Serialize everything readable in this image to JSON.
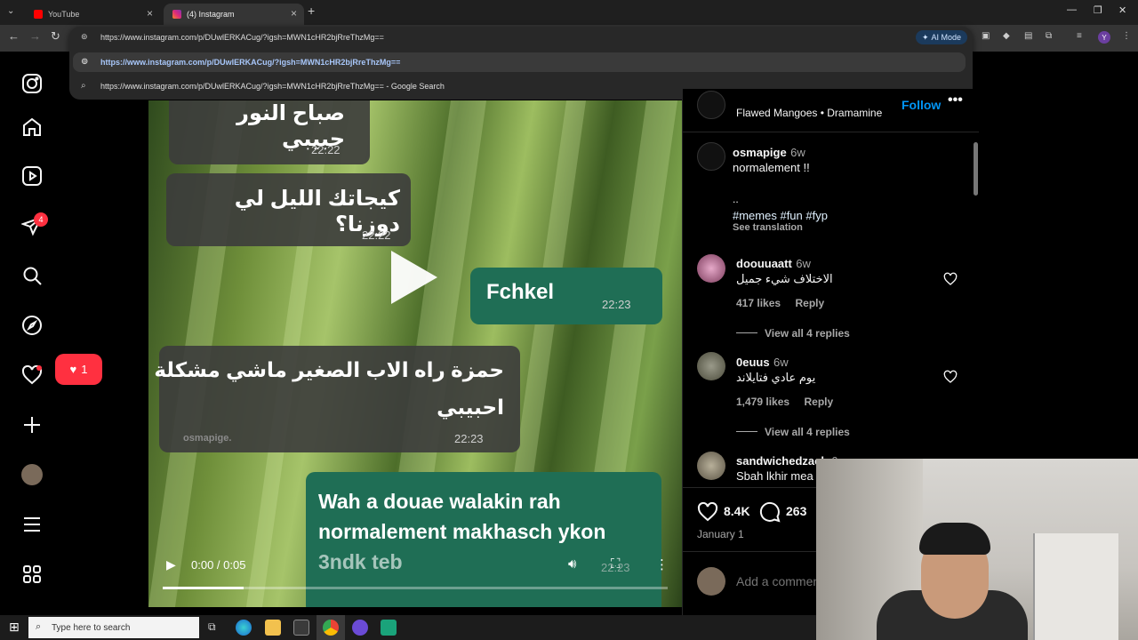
{
  "browser": {
    "tabs": [
      {
        "title": "YouTube"
      },
      {
        "title": "(4) Instagram"
      }
    ],
    "url": "https://www.instagram.com/p/DUwlERKACug/?igsh=MWN1cHR2bjRreThzMg==",
    "suggestions": [
      {
        "text": "https://www.instagram.com/p/DUwlERKACug/?igsh=MWN1cHR2bjRreThzMg=="
      },
      {
        "text": "https://www.instagram.com/p/DUwlERKACug/?igsh=MWN1cHR2bjRreThzMg== - Google Search"
      }
    ],
    "ai_mode_label": "AI Mode",
    "profile_initial": "Y"
  },
  "instagram": {
    "notifications_count": "4",
    "likes_bubble_count": "1",
    "post_header": {
      "audio": "Flawed Mangoes • Dramamine",
      "follow_label": "Follow"
    },
    "caption": {
      "username": "osmapige",
      "time": "6w",
      "text": "normalement !!",
      "dots": "..",
      "hashtags": "#memes #fun #fyp",
      "see_translation": "See translation"
    },
    "comments": [
      {
        "username": "doouuaatt",
        "time": "6w",
        "text": "الاختلاف شيء جميل",
        "likes": "417 likes",
        "reply": "Reply",
        "view_replies": "View all 4 replies"
      },
      {
        "username": "0euus",
        "time": "6w",
        "text": "يوم عادي فتايلاند",
        "likes": "1,479 likes",
        "reply": "Reply",
        "view_replies": "View all 4 replies"
      },
      {
        "username": "sandwichedzack",
        "time": "6w",
        "text": "Sbah lkhir mea"
      }
    ],
    "actions": {
      "likes": "8.4K",
      "comments": "263",
      "date": "January 1",
      "add_comment_placeholder": "Add a comment..."
    },
    "video": {
      "time_display": "0:00 / 0:05",
      "progress_fraction": 0.16,
      "messages": [
        {
          "text": "صباح النور حبيبي",
          "time": "22:22"
        },
        {
          "text": "كيجاتك الليل لي دوزنا؟",
          "time": "22:22"
        },
        {
          "text": "Fchkel",
          "time": "22:23"
        },
        {
          "text_line1": "حمزة راه الاب الصغير ماشي مشكلة",
          "text_line2": "احبيبي",
          "watermark": "osmapige.",
          "time": "22:23"
        },
        {
          "text_line1": "Wah a douae walakin rah",
          "text_line2": "normalement makhasch ykon",
          "text_line3": "3ndk teb",
          "time": "22:23"
        }
      ]
    }
  },
  "taskbar": {
    "search_placeholder": "Type here to search"
  },
  "colors": {
    "instagram_red": "#ff3040",
    "link_blue": "#a8c7fa",
    "hashtag_blue": "#e0f1ff",
    "chat_green": "#1f6e55"
  }
}
